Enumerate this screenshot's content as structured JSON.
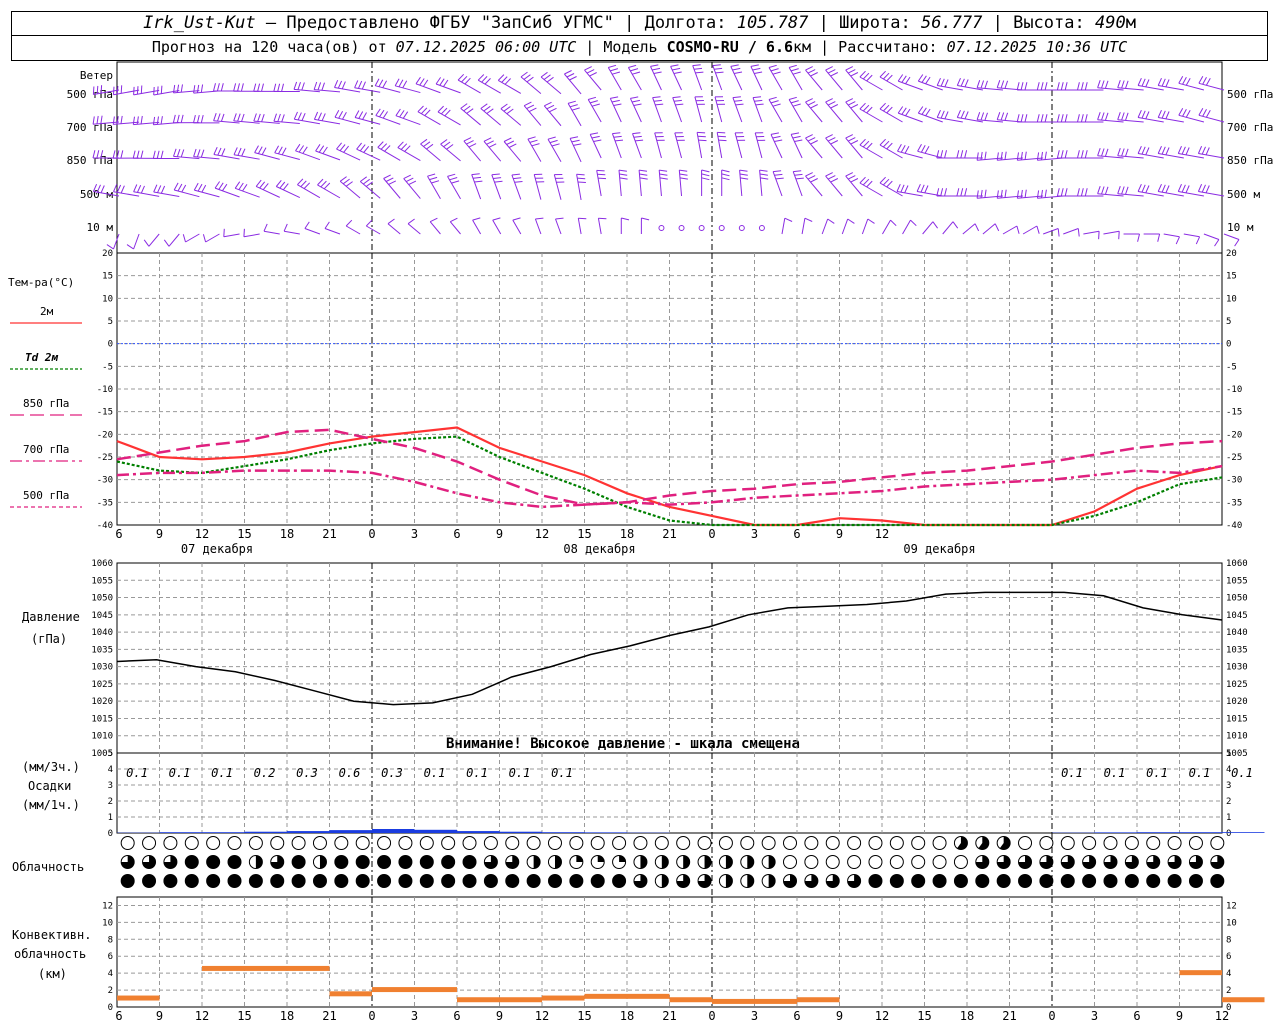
{
  "header": {
    "station": "Irk_Ust-Kut",
    "provider": " – Предоставлено ФГБУ \"ЗапСиб УГМС\" | Долгота: ",
    "lon": "105.787",
    "lat_label": " | Широта: ",
    "lat": "56.777",
    "alt_label": " | Высота: ",
    "alt": "490",
    "alt_unit": "м",
    "forecast_label": "Прогноз на 120 часа(ов) от ",
    "forecast_time": "07.12.2025 06:00 UTC",
    "model_label": " | Модель ",
    "model": "COSMO-RU / 6.6",
    "model_unit": "км",
    "calc_label": " | Рассчитано: ",
    "calc_time": "07.12.2025 10:36 UTC"
  },
  "wind_panel": {
    "title": "Ветер",
    "levels": [
      "500 гПа",
      "700 гПа",
      "850 гПа",
      "500 м",
      "10 м"
    ]
  },
  "temp_panel": {
    "title": "Тем-ра(°C)",
    "legend": [
      {
        "label": "2м",
        "color": "#ff3333",
        "dash": "none"
      },
      {
        "label": "Td 2м",
        "color": "#008000",
        "dash": "3,2"
      },
      {
        "label": "850 гПа",
        "color": "#e0207f",
        "dash": "14,6"
      },
      {
        "label": "700 гПа",
        "color": "#e0207f",
        "dash": "12,4,3,4"
      },
      {
        "label": "500 гПа",
        "color": "#e0207f",
        "dash": "4,3"
      }
    ],
    "y_ticks": [
      "20",
      "15",
      "10",
      "5",
      "0",
      "-5",
      "-10",
      "-15",
      "-20",
      "-25",
      "-30",
      "-35",
      "-40"
    ]
  },
  "time_axis": {
    "hours": [
      "6",
      "9",
      "12",
      "15",
      "18",
      "21",
      "0",
      "3",
      "6",
      "9",
      "12",
      "15",
      "18",
      "21",
      "0",
      "3",
      "6",
      "9",
      "12"
    ],
    "days": [
      "07 декабря",
      "08 декабря",
      "09 декабря"
    ],
    "bottom_hours": [
      "6",
      "9",
      "12",
      "15",
      "18",
      "21",
      "0",
      "3",
      "6",
      "9",
      "12",
      "15",
      "18",
      "21",
      "0",
      "3",
      "6",
      "9",
      "12",
      "15",
      "18",
      "21",
      "0",
      "3",
      "6",
      "9",
      "12"
    ]
  },
  "pressure_panel": {
    "label1": "Давление",
    "label2": "(гПа)",
    "warning": "Внимание! Высокое давление - шкала смещена",
    "y_ticks": [
      "1060",
      "1055",
      "1050",
      "1045",
      "1040",
      "1035",
      "1030",
      "1025",
      "1020",
      "1015",
      "1010",
      "1005"
    ]
  },
  "precip_panel": {
    "label_top": "(мм/3ч.)",
    "label_mid": "Осадки",
    "label_bot": "(мм/1ч.)",
    "y_ticks": [
      "5",
      "4",
      "3",
      "2",
      "1",
      "0"
    ],
    "values": [
      "0.1",
      "0.1",
      "0.1",
      "0.2",
      "0.3",
      "0.6",
      "0.3",
      "0.1",
      "0.1",
      "0.1",
      "0.1",
      "0.1",
      "0.1",
      "0.1",
      "0.1",
      "0.1"
    ]
  },
  "cloud_panel": {
    "label": "Облачность"
  },
  "conv_panel": {
    "label1": "Конвективн.",
    "label2": "облачность",
    "label3": "(км)",
    "y_ticks": [
      "12",
      "10",
      "8",
      "6",
      "4",
      "2",
      "0"
    ]
  },
  "chart_data": [
    {
      "type": "line",
      "title": "Тем-ра(°C)",
      "x_hours": [
        0,
        3,
        6,
        9,
        12,
        15,
        18,
        21,
        24,
        27,
        30,
        33,
        36,
        39,
        42,
        45,
        48,
        51,
        54,
        57,
        60,
        63,
        66,
        69,
        72,
        75,
        78
      ],
      "ylim": [
        -40,
        20
      ],
      "series": [
        {
          "name": "2м",
          "values": [
            -21.5,
            -25,
            -25.5,
            -25,
            -24,
            -22,
            -20.5,
            -19.5,
            -18.5,
            -23,
            -26,
            -29,
            -33,
            -36,
            -38,
            -40,
            -40,
            -38.5,
            -39,
            -40,
            -40,
            -40,
            -40,
            -37,
            -32,
            -29,
            -27
          ]
        },
        {
          "name": "Td 2м",
          "values": [
            -26,
            -28,
            -28.5,
            -27,
            -25.5,
            -23.5,
            -22,
            -21,
            -20.5,
            -25,
            -28.5,
            -32,
            -36,
            -39,
            -40,
            -40,
            -40,
            -40,
            -40,
            -40,
            -40,
            -40,
            -40,
            -38,
            -35,
            -31,
            -29.5
          ]
        },
        {
          "name": "850 гПа",
          "values": [
            -25.5,
            -24,
            -22.5,
            -21.5,
            -19.5,
            -19,
            -21,
            -23,
            -26,
            -30,
            -33.5,
            -35.5,
            -35,
            -33.5,
            -32.5,
            -32,
            -31,
            -30.5,
            -29.5,
            -28.5,
            -28,
            -27,
            -26,
            -24.5,
            -23,
            -22,
            -21.5
          ]
        },
        {
          "name": "700 гПа",
          "values": [
            -29,
            -28.5,
            -28.5,
            -28,
            -28,
            -28,
            -28.5,
            -30.5,
            -33,
            -35,
            -36,
            -35.5,
            -35,
            -35.5,
            -35,
            -34,
            -33.5,
            -33,
            -32.5,
            -31.5,
            -31,
            -30.5,
            -30,
            -29,
            -28,
            -28.5,
            -27
          ]
        },
        {
          "name": "500 гПа",
          "values": []
        }
      ]
    },
    {
      "type": "line",
      "title": "Давление",
      "x_hours": [
        0,
        3,
        6,
        9,
        12,
        15,
        18,
        21,
        24,
        27,
        30,
        33,
        36,
        39,
        42,
        45,
        48,
        51,
        54,
        57,
        60,
        63,
        66,
        69,
        72,
        75,
        78
      ],
      "ylim": [
        1005,
        1060
      ],
      "series": [
        {
          "name": "Давление",
          "values": [
            1031.5,
            1032,
            1030,
            1028.5,
            1026,
            1023,
            1020,
            1019,
            1019.5,
            1022,
            1027,
            1030,
            1033.5,
            1036,
            1039,
            1041.5,
            1045,
            1047,
            1047.5,
            1048,
            1049,
            1051,
            1051.5,
            1051.5,
            1051.5,
            1050.5,
            1047,
            1045,
            1043.5
          ]
        }
      ]
    },
    {
      "type": "bar",
      "title": "Осадки",
      "x_hours": [
        0,
        3,
        6,
        9,
        12,
        15,
        18,
        21,
        24,
        27,
        30,
        33,
        36,
        39,
        42,
        45,
        48,
        51,
        54,
        57,
        60,
        63,
        66,
        69,
        72,
        75,
        78
      ],
      "ylim": [
        0,
        5
      ],
      "values": [
        0.02,
        0.05,
        0.05,
        0.08,
        0.12,
        0.18,
        0.25,
        0.2,
        0.12,
        0.08,
        0.05,
        0.04,
        0.02,
        0,
        0,
        0,
        0,
        0,
        0,
        0,
        0,
        0,
        0.02,
        0.04,
        0.05,
        0.05,
        0.05
      ]
    },
    {
      "type": "bar",
      "title": "Конвективн. облачность",
      "x_hours": [
        0,
        3,
        6,
        9,
        12,
        15,
        18,
        21,
        24,
        27,
        30,
        33,
        36,
        39,
        42,
        45,
        48,
        51,
        54,
        57,
        60,
        63,
        66,
        69,
        72,
        75,
        78
      ],
      "ylim": [
        0,
        13
      ],
      "values": [
        1,
        0,
        4.5,
        4.5,
        4.5,
        1.5,
        2,
        2,
        0.8,
        0.8,
        1,
        1.2,
        1.2,
        0.8,
        0.6,
        0.6,
        0.8,
        0,
        0,
        0,
        0,
        0,
        0,
        0,
        0,
        4,
        0.8
      ]
    }
  ],
  "colors": {
    "wind": "#8a2be2",
    "grid": "#999999",
    "temp2m": "#ff3333",
    "td": "#008000",
    "upper": "#e0207f",
    "pressure": "#000000",
    "precip": "#1a3ce0",
    "conv": "#f08030",
    "zero_line": "#3355ff"
  },
  "wind_data": {
    "rows": [
      {
        "dir": [
          260,
          260,
          265,
          270,
          270,
          275,
          280,
          285,
          290,
          300,
          310,
          320,
          330,
          335,
          340,
          335,
          330,
          320,
          300,
          290,
          280,
          275,
          270,
          270,
          275,
          280,
          285
        ]
      },
      {
        "dir": [
          265,
          265,
          270,
          275,
          275,
          280,
          285,
          290,
          300,
          310,
          320,
          330,
          335,
          340,
          345,
          340,
          330,
          320,
          300,
          290,
          280,
          275,
          270,
          270,
          275,
          280,
          285
        ]
      },
      {
        "dir": [
          270,
          270,
          275,
          280,
          285,
          290,
          295,
          300,
          310,
          320,
          330,
          335,
          340,
          345,
          350,
          345,
          335,
          320,
          300,
          285,
          270,
          265,
          265,
          270,
          275,
          280,
          280
        ]
      },
      {
        "dir": [
          280,
          280,
          285,
          290,
          295,
          300,
          310,
          320,
          330,
          340,
          345,
          350,
          355,
          355,
          0,
          355,
          340,
          320,
          300,
          280,
          270,
          265,
          265,
          270,
          275,
          280,
          280
        ]
      },
      {
        "dir": [
          200,
          220,
          240,
          260,
          280,
          290,
          300,
          310,
          320,
          330,
          340,
          350,
          0,
          null,
          null,
          null,
          10,
          20,
          30,
          40,
          50,
          60,
          70,
          80,
          90,
          100,
          110
        ]
      }
    ]
  }
}
